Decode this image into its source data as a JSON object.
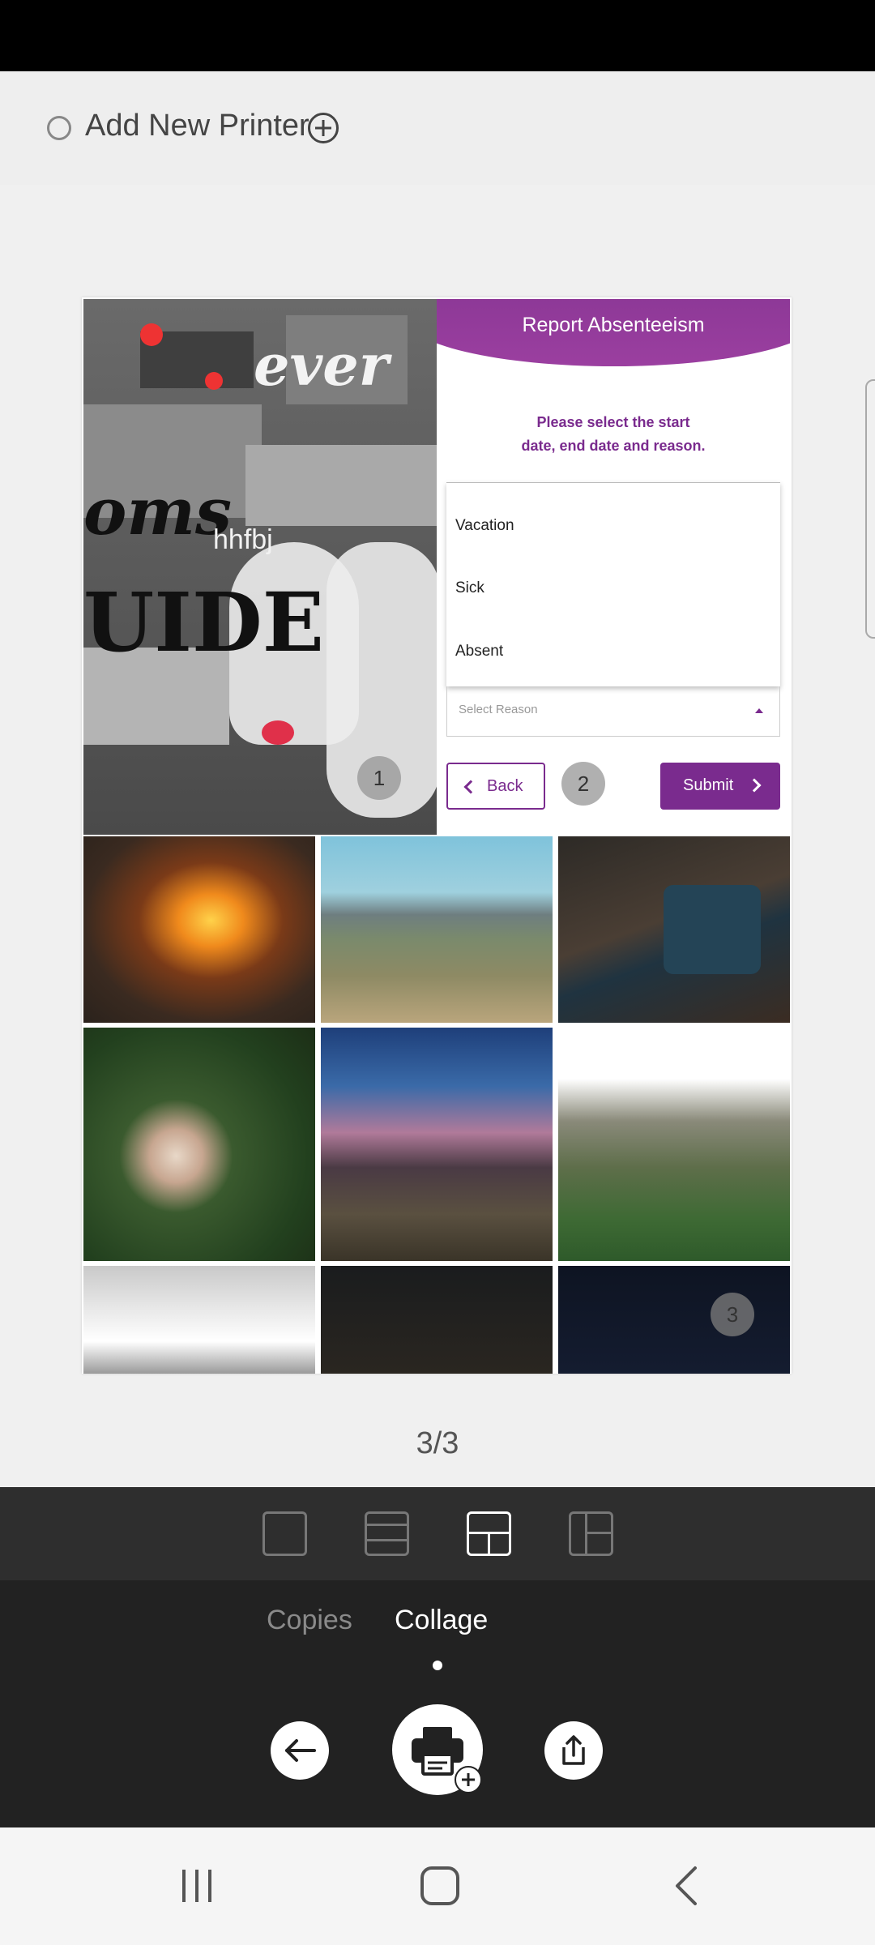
{
  "printer_bar": {
    "label": "Add New Printer",
    "radio_icon": "radio-unchecked-icon",
    "add_icon": "plus-circle-icon"
  },
  "collage": {
    "poster": {
      "title_top": "ever",
      "title_mid": "oms",
      "title_low": "UIDE",
      "overlay_text": "hhfbj",
      "badge": "1"
    },
    "app_screenshot": {
      "title": "Report Absenteeism",
      "instruction": "Please select the start\ndate, end date and reason.",
      "dropdown_options": [
        "Vacation",
        "Sick",
        "Absent"
      ],
      "select_placeholder": "Select Reason",
      "back_label": "Back",
      "submit_label": "Submit",
      "badge": "2",
      "accent_color": "#7a2b8e"
    },
    "tile_badge": "3"
  },
  "page_indicator": "3/3",
  "layout_options": [
    "single-layout-icon",
    "two-row-layout-icon",
    "three-split-layout-icon",
    "side-split-layout-icon"
  ],
  "active_layout": "three-split-layout-icon",
  "tabs": {
    "copies": "Copies",
    "collage": "Collage",
    "active": "Collage"
  },
  "actions": {
    "back_icon": "arrow-left-icon",
    "print_icon": "printer-icon",
    "share_icon": "share-icon"
  },
  "nav": {
    "recents_icon": "recents-icon",
    "home_icon": "home-icon",
    "back_icon": "nav-back-icon"
  }
}
